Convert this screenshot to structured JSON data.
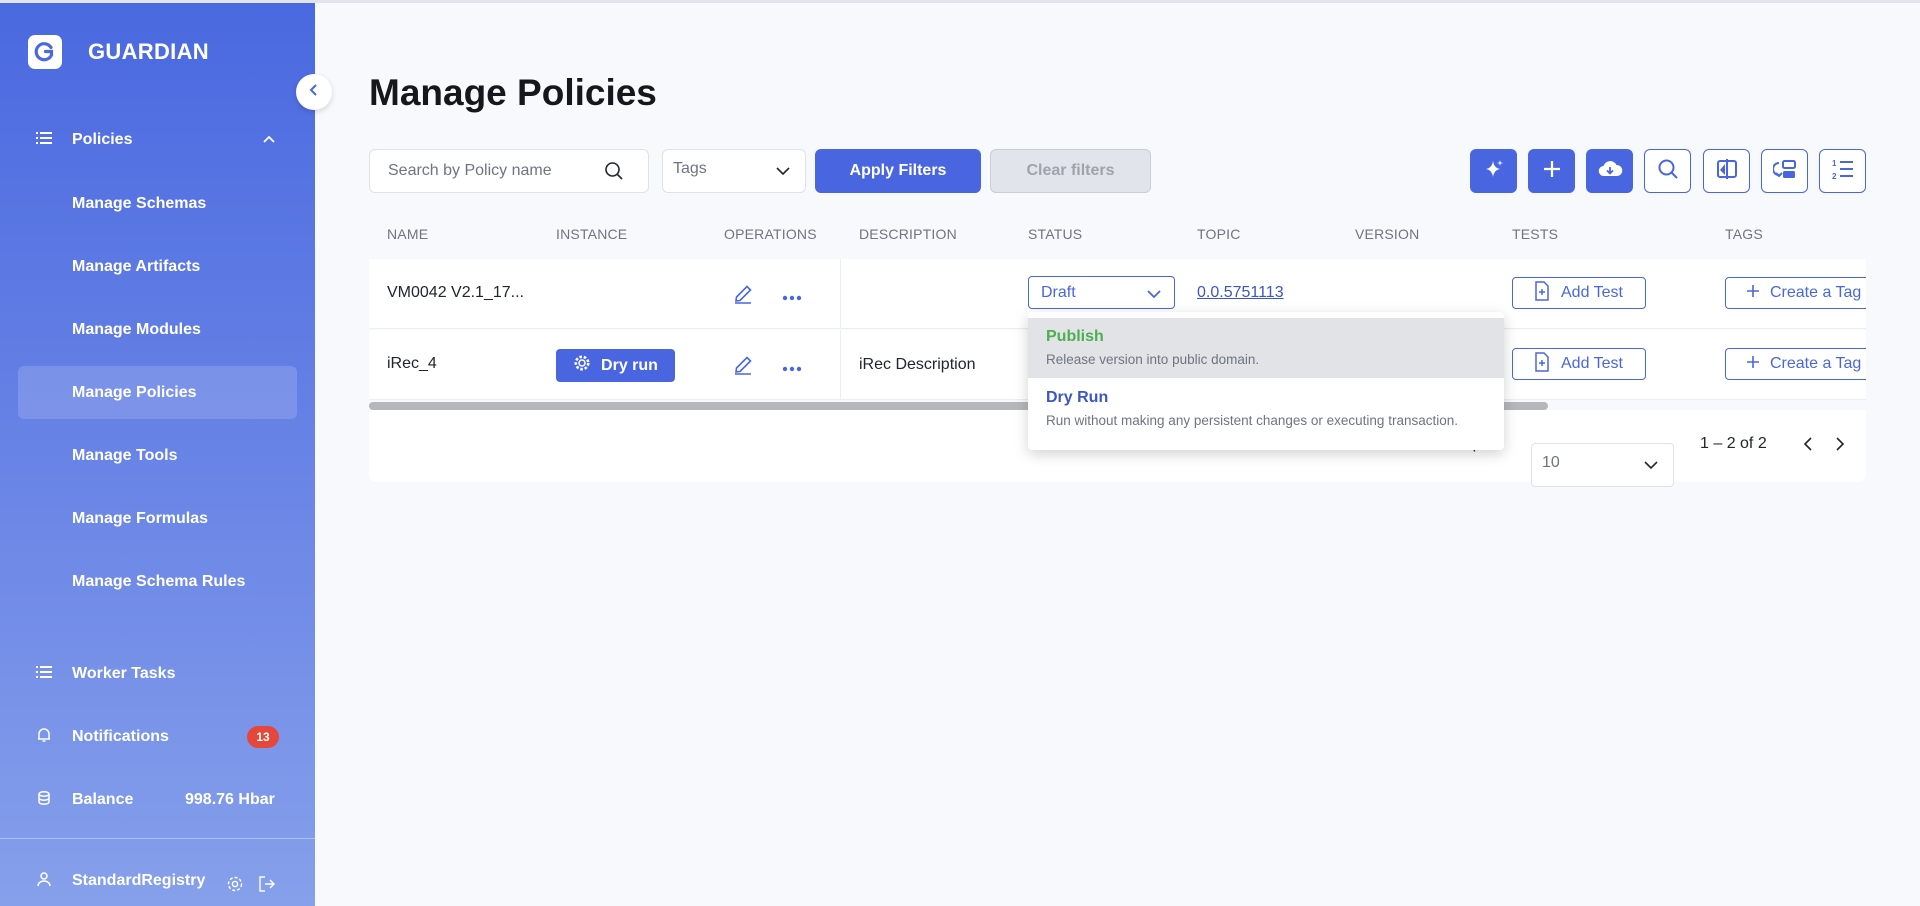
{
  "app": {
    "name": "GUARDIAN"
  },
  "sidebar": {
    "policies_group": {
      "label": "Policies"
    },
    "sub_items": [
      {
        "label": "Manage Schemas"
      },
      {
        "label": "Manage Artifacts"
      },
      {
        "label": "Manage Modules"
      },
      {
        "label": "Manage Policies",
        "active": true
      },
      {
        "label": "Manage Tools"
      },
      {
        "label": "Manage Formulas"
      },
      {
        "label": "Manage Schema Rules"
      }
    ],
    "worker_tasks": {
      "label": "Worker Tasks"
    },
    "notifications": {
      "label": "Notifications",
      "count": "13"
    },
    "balance": {
      "label": "Balance",
      "value": "998.76 Hbar"
    },
    "user": {
      "label": "StandardRegistry"
    }
  },
  "page": {
    "title": "Manage Policies"
  },
  "filters": {
    "search_placeholder": "Search by Policy name",
    "tags_placeholder": "Tags",
    "apply_label": "Apply Filters",
    "clear_label": "Clear filters"
  },
  "toolbar": {
    "icons": [
      "sparkle-icon",
      "plus-icon",
      "cloud-download-icon",
      "search-icon",
      "compare-icon",
      "policy-flow-icon",
      "ordered-list-icon"
    ]
  },
  "table": {
    "headers": [
      "NAME",
      "INSTANCE",
      "OPERATIONS",
      "DESCRIPTION",
      "STATUS",
      "TOPIC",
      "VERSION",
      "TESTS",
      "TAGS"
    ],
    "rows": [
      {
        "name": "VM0042 V2.1_17...",
        "instance": "",
        "description": "",
        "status": "Draft",
        "topic": "0.0.5751113",
        "version": "",
        "tests_label": "Add Test",
        "tags_label": "Create a Tag"
      },
      {
        "name": "iRec_4",
        "instance": "Dry run",
        "description": "iRec Description",
        "status": "",
        "topic": "",
        "version": "",
        "tests_label": "Add Test",
        "tags_label": "Create a Tag"
      }
    ]
  },
  "pagination": {
    "per_page_label": "Items per page",
    "page_size": "10",
    "range": "1 – 2 of 2"
  },
  "status_dropdown": {
    "options": [
      {
        "title": "Publish",
        "description": "Release version into public domain.",
        "color": "#4caf50"
      },
      {
        "title": "Dry Run",
        "description": "Run without making any persistent changes or executing transaction.",
        "color": "#3c55c8"
      }
    ]
  },
  "colors": {
    "accent": "#4966e0",
    "badge": "#e5483b"
  }
}
